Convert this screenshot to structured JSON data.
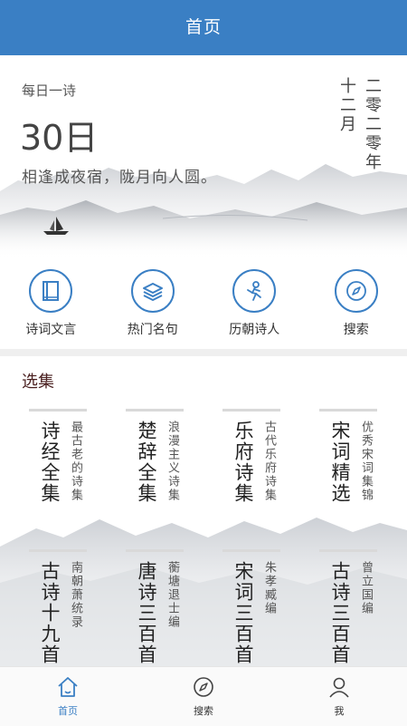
{
  "header": {
    "title": "首页"
  },
  "daily": {
    "label": "每日一诗",
    "day": "30日",
    "poem": "相逢成夜宿，陇月向人圆。",
    "year": "二零二零年",
    "month": "十二月"
  },
  "quick_actions": [
    {
      "label": "诗词文言",
      "icon": "book-icon"
    },
    {
      "label": "热门名句",
      "icon": "layers-icon"
    },
    {
      "label": "历朝诗人",
      "icon": "poet-icon"
    },
    {
      "label": "搜索",
      "icon": "compass-icon"
    }
  ],
  "collection": {
    "title": "选集",
    "items": [
      {
        "title": "诗经全集",
        "subtitle": "最古老的诗集"
      },
      {
        "title": "楚辞全集",
        "subtitle": "浪漫主义诗集"
      },
      {
        "title": "乐府诗集",
        "subtitle": "古代乐府诗集"
      },
      {
        "title": "宋词精选",
        "subtitle": "优秀宋词集锦"
      },
      {
        "title": "古诗十九首",
        "subtitle": "南朝萧统录"
      },
      {
        "title": "唐诗三百首",
        "subtitle": "蘅塘退士编"
      },
      {
        "title": "宋词三百首",
        "subtitle": "朱孝臧编"
      },
      {
        "title": "古诗三百首",
        "subtitle": "曾立国编"
      }
    ]
  },
  "tabbar": {
    "items": [
      {
        "label": "首页",
        "icon": "home-icon",
        "active": true
      },
      {
        "label": "搜索",
        "icon": "compass-icon",
        "active": false
      },
      {
        "label": "我",
        "icon": "person-icon",
        "active": false
      }
    ]
  },
  "colors": {
    "primary": "#3a7fc4",
    "section_title": "#4a2020"
  }
}
